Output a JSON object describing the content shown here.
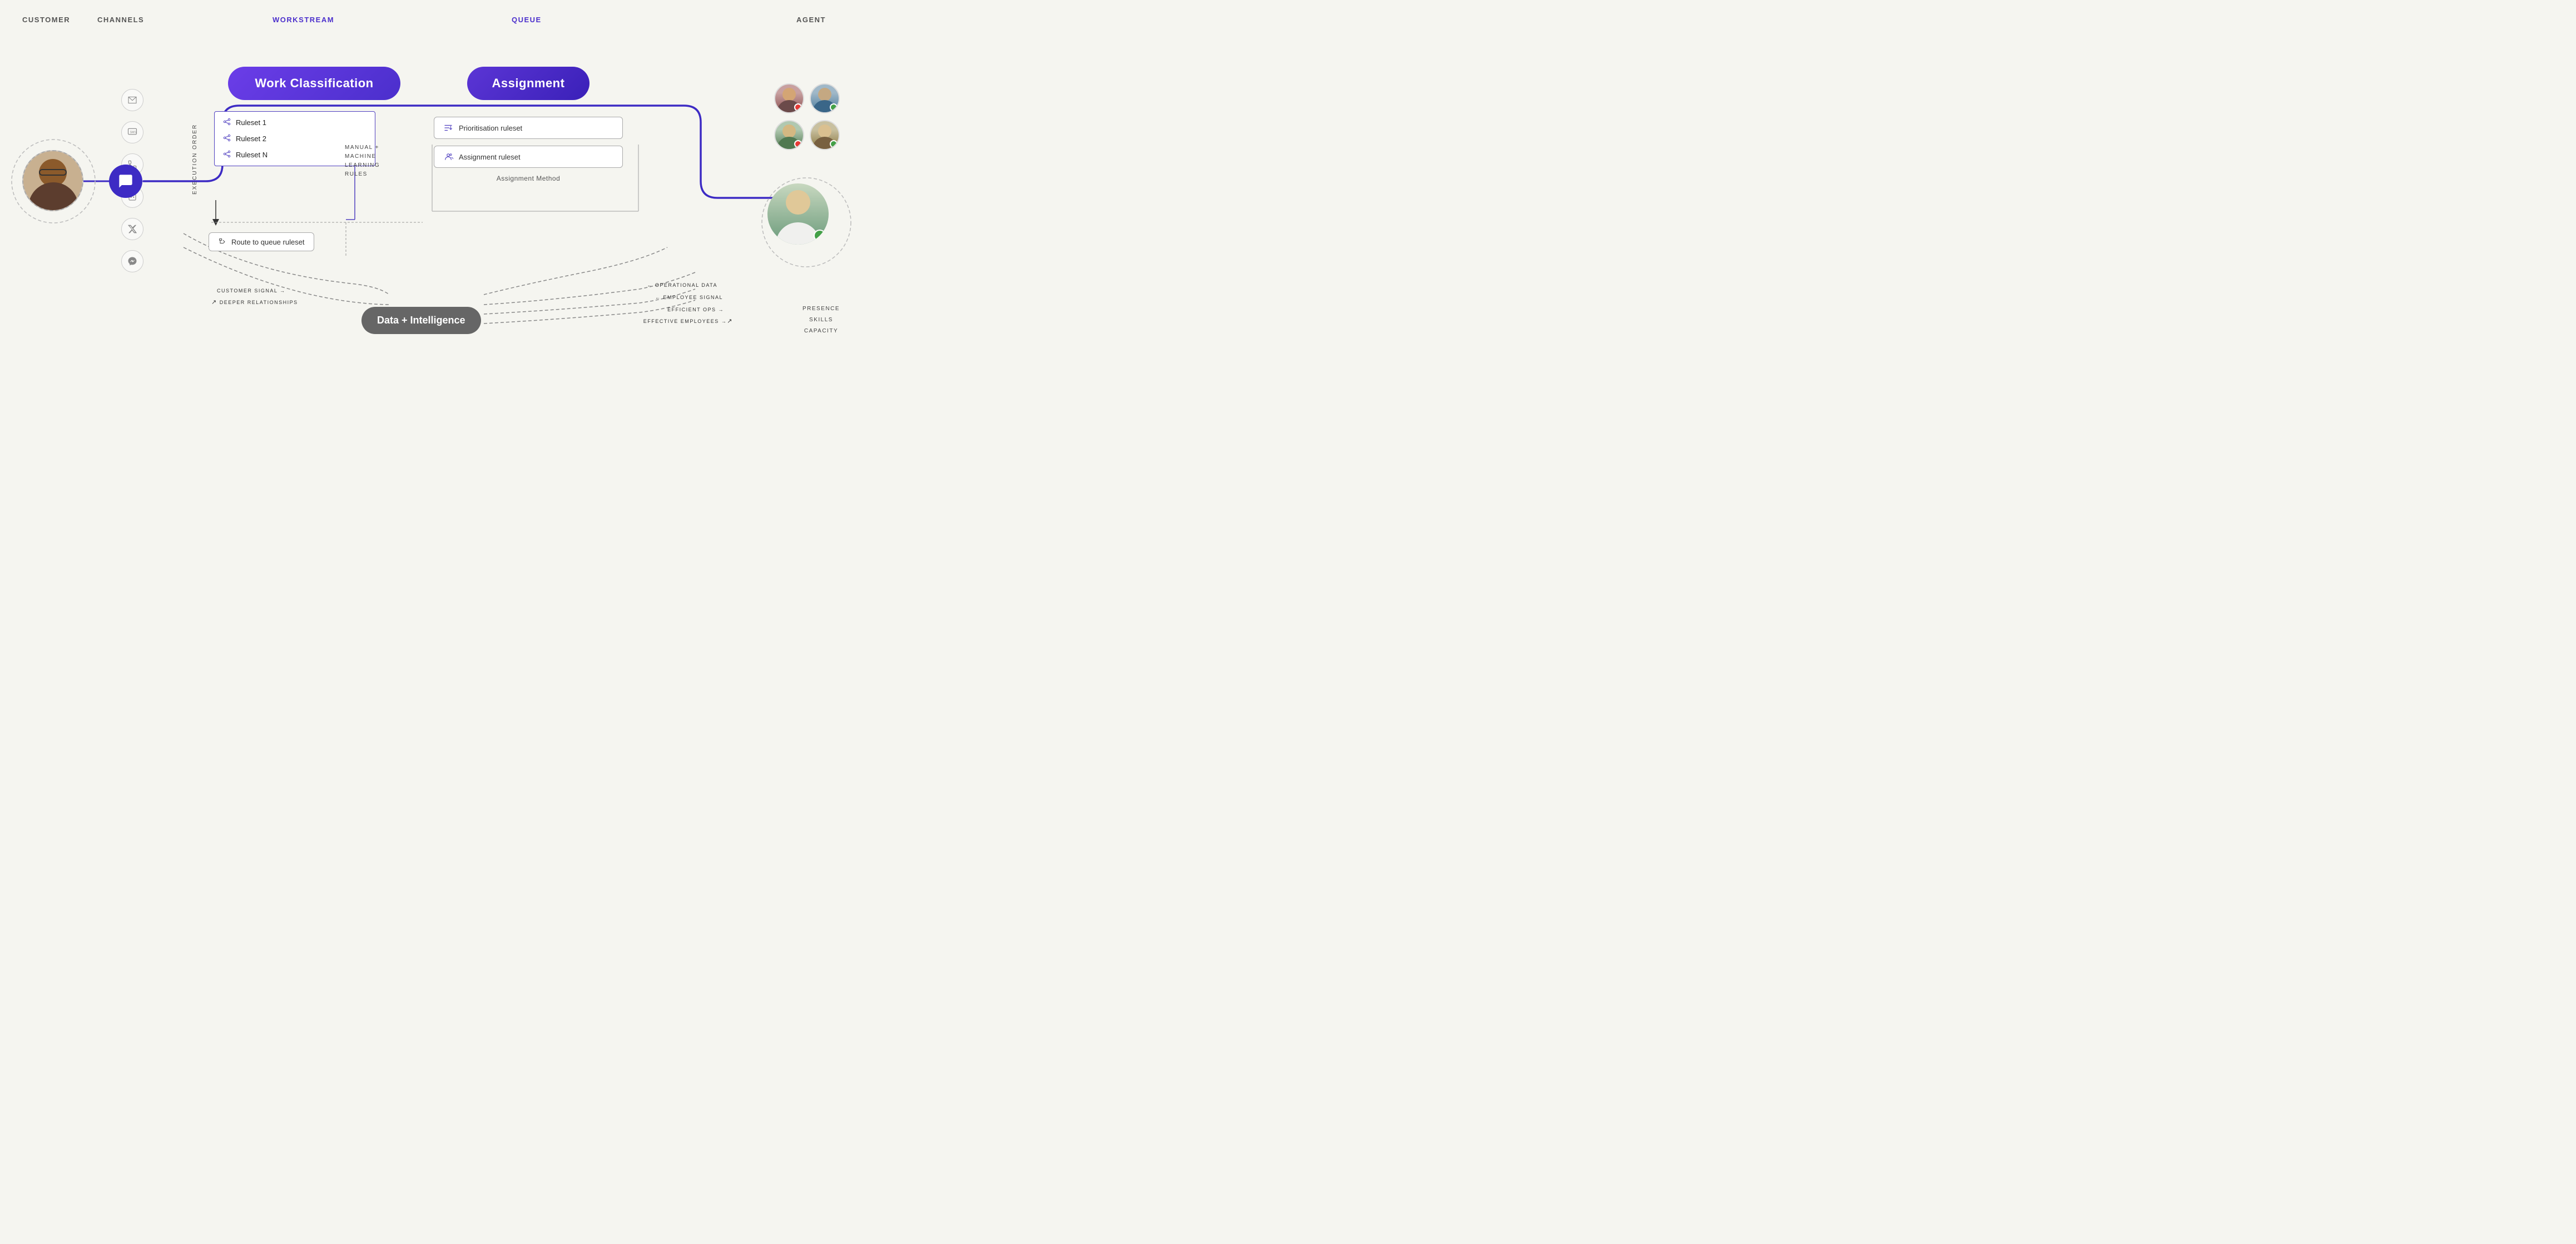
{
  "header": {
    "customer_label": "CUSTOMER",
    "channels_label": "CHANNELS",
    "workstream_label": "WORKSTREAM",
    "queue_label": "QUEUE",
    "agent_label": "AGENT"
  },
  "pills": {
    "work_classification": "Work Classification",
    "assignment": "Assignment"
  },
  "workstream": {
    "execution_order": "EXECUTION ORDER",
    "rulesets": [
      "Ruleset 1",
      "Ruleset 2",
      "Ruleset N"
    ],
    "ml_rules_line1": "MANUAL +",
    "ml_rules_line2": "MACHINE",
    "ml_rules_line3": "LEARNING",
    "ml_rules_line4": "RULES",
    "route_to_queue": "Route to queue ruleset"
  },
  "queue_section": {
    "prioritisation_label": "Prioritisation ruleset",
    "assignment_ruleset_label": "Assignment ruleset",
    "assignment_method_label": "Assignment Method"
  },
  "data_intelligence": {
    "label": "Data + Intelligence",
    "arrows": {
      "customer_signal": "CUSTOMER SIGNAL →",
      "deeper_relationships": "DEEPER RELATIONSHIPS",
      "operational_data": "← OPERATIONAL DATA",
      "employee_signal": "← EMPLOYEE SIGNAL",
      "efficient_ops": "EFFICIENT OPS →",
      "effective_employees": "EFFECTIVE EMPLOYEES →"
    }
  },
  "agent": {
    "presence_label": "PRESENCE",
    "skills_label": "SKILLS",
    "capacity_label": "CAPACITY"
  },
  "channels": {
    "icons": [
      "✉",
      "💬",
      "☎",
      "⬡",
      "𝕏",
      "💬"
    ]
  }
}
